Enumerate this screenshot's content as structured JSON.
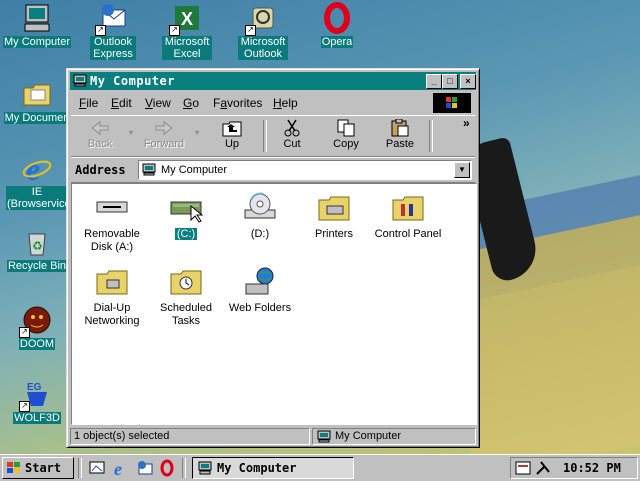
{
  "desktop": {
    "icons": [
      {
        "label": "My Computer",
        "icon": "computer-icon"
      },
      {
        "label": "Outlook Express",
        "icon": "outlook-express-icon",
        "shortcut": true
      },
      {
        "label": "Microsoft Excel",
        "icon": "excel-icon",
        "shortcut": true
      },
      {
        "label": "Microsoft Outlook",
        "icon": "outlook-icon",
        "shortcut": true
      },
      {
        "label": "Opera",
        "icon": "opera-icon"
      },
      {
        "label": "My Documen",
        "icon": "folder-documents-icon"
      },
      {
        "label": "IE (Browservice",
        "icon": "ie-icon"
      },
      {
        "label": "Recycle Bin",
        "icon": "recycle-bin-icon"
      },
      {
        "label": "DOOM",
        "icon": "doom-icon",
        "shortcut": true
      },
      {
        "label": "WOLF3D",
        "icon": "wolf3d-icon",
        "shortcut": true
      }
    ]
  },
  "window": {
    "title": "My Computer",
    "controls": {
      "minimize": "_",
      "maximize": "□",
      "close": "×"
    },
    "menu": [
      {
        "label": "File",
        "hot": "F"
      },
      {
        "label": "Edit",
        "hot": "E"
      },
      {
        "label": "View",
        "hot": "V"
      },
      {
        "label": "Go",
        "hot": "G"
      },
      {
        "label": "Favorites",
        "hot": "a"
      },
      {
        "label": "Help",
        "hot": "H"
      }
    ],
    "toolbar": {
      "back": "Back",
      "forward": "Forward",
      "up": "Up",
      "cut": "Cut",
      "copy": "Copy",
      "paste": "Paste",
      "more": "»"
    },
    "address": {
      "label": "Address",
      "value": "My Computer"
    },
    "items": [
      {
        "label": "Removable Disk (A:)",
        "icon": "floppy-drive-icon"
      },
      {
        "label": "(C:)",
        "icon": "hard-drive-icon",
        "selected": true
      },
      {
        "label": "(D:)",
        "icon": "cd-drive-icon"
      },
      {
        "label": "Printers",
        "icon": "printers-folder-icon"
      },
      {
        "label": "Control Panel",
        "icon": "control-panel-icon"
      },
      {
        "label": "Dial-Up Networking",
        "icon": "dialup-networking-icon"
      },
      {
        "label": "Scheduled Tasks",
        "icon": "scheduled-tasks-icon"
      },
      {
        "label": "Web Folders",
        "icon": "web-folders-icon"
      }
    ],
    "status": {
      "left": "1 object(s) selected",
      "right": "My Computer"
    }
  },
  "taskbar": {
    "start": "Start",
    "quick_launch": [
      "desktop-icon",
      "ie-icon",
      "outlook-express-icon",
      "opera-icon"
    ],
    "task_button": "My Computer",
    "clock": "10:52 PM"
  },
  "colors": {
    "titlebar": "#0a7f7f",
    "face": "#c0c0c0",
    "selection": "#0a7f7f"
  }
}
